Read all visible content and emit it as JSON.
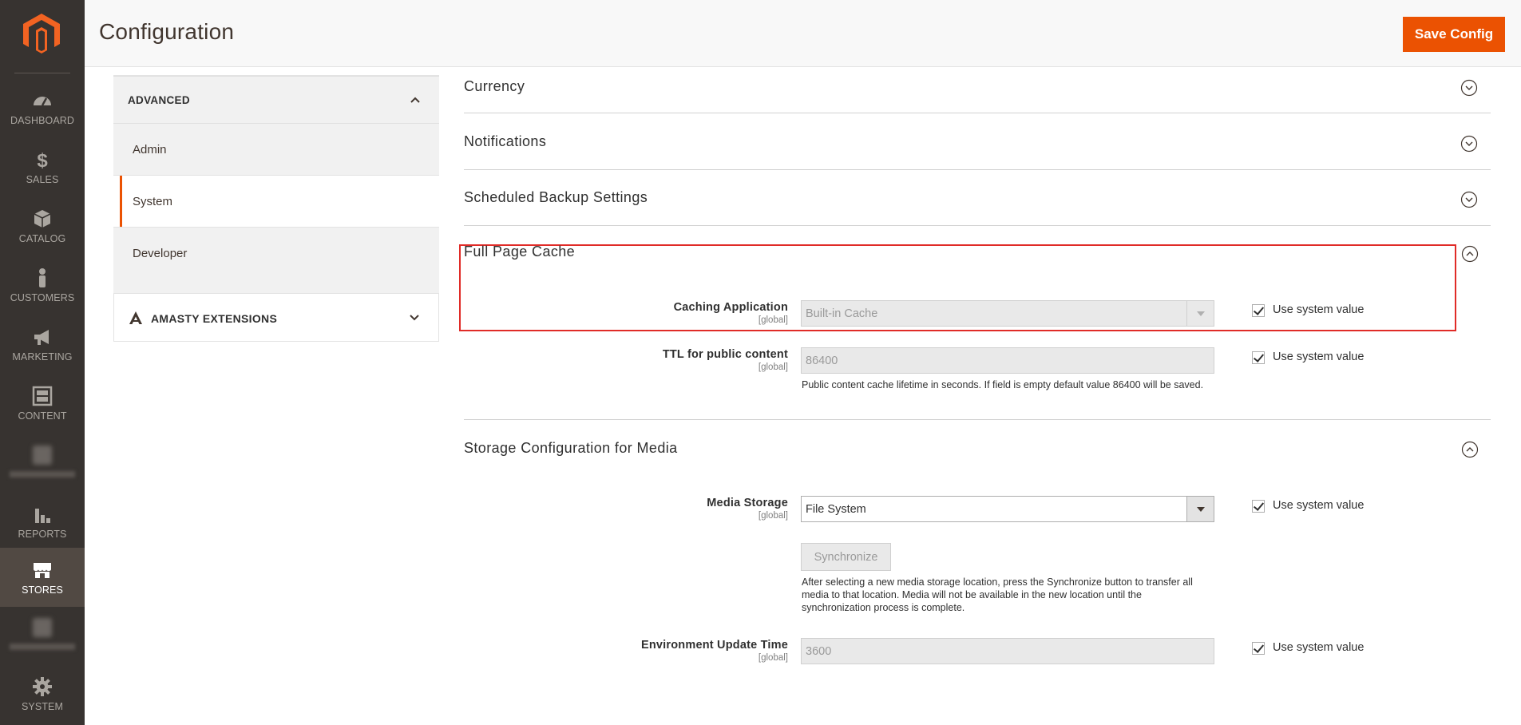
{
  "header": {
    "title": "Configuration",
    "save_label": "Save Config"
  },
  "nav": {
    "items": [
      {
        "label": "DASHBOARD",
        "icon": "dashboard-icon"
      },
      {
        "label": "SALES",
        "icon": "dollar-icon"
      },
      {
        "label": "CATALOG",
        "icon": "cube-icon"
      },
      {
        "label": "CUSTOMERS",
        "icon": "person-icon"
      },
      {
        "label": "MARKETING",
        "icon": "megaphone-icon"
      },
      {
        "label": "CONTENT",
        "icon": "content-icon"
      },
      {
        "label": "REPORTS",
        "icon": "bar-chart-icon"
      },
      {
        "label": "STORES",
        "icon": "store-icon"
      },
      {
        "label": "SYSTEM",
        "icon": "gear-icon"
      }
    ],
    "active": "STORES"
  },
  "tabs": {
    "advanced": {
      "title": "ADVANCED",
      "items": [
        "Admin",
        "System",
        "Developer"
      ],
      "active": "System"
    },
    "amasty": {
      "title": "AMASTY EXTENSIONS"
    }
  },
  "sections": {
    "currency": "Currency",
    "notifications": "Notifications",
    "backup": "Scheduled Backup Settings",
    "fpc": {
      "title": "Full Page Cache",
      "caching_app": {
        "label": "Caching Application",
        "scope": "[global]",
        "value": "Built-in Cache",
        "use_system": "Use system value"
      },
      "ttl": {
        "label": "TTL for public content",
        "scope": "[global]",
        "value": "86400",
        "use_system": "Use system value",
        "note": "Public content cache lifetime in seconds. If field is empty default value 86400 will be saved."
      }
    },
    "media": {
      "title": "Storage Configuration for Media",
      "storage": {
        "label": "Media Storage",
        "scope": "[global]",
        "value": "File System",
        "use_system": "Use system value"
      },
      "sync_label": "Synchronize",
      "sync_note_1": "After selecting a new media storage location, press the Synchronize button to transfer all",
      "sync_note_2": "media to that location. Media will not be available in the new location until the",
      "sync_note_3": "synchronization process is complete.",
      "env": {
        "label": "Environment Update Time",
        "scope": "[global]",
        "value": "3600",
        "use_system": "Use system value"
      }
    }
  },
  "colors": {
    "accent": "#eb5202",
    "nav_bg": "#373330",
    "highlight": "#e02b27"
  }
}
